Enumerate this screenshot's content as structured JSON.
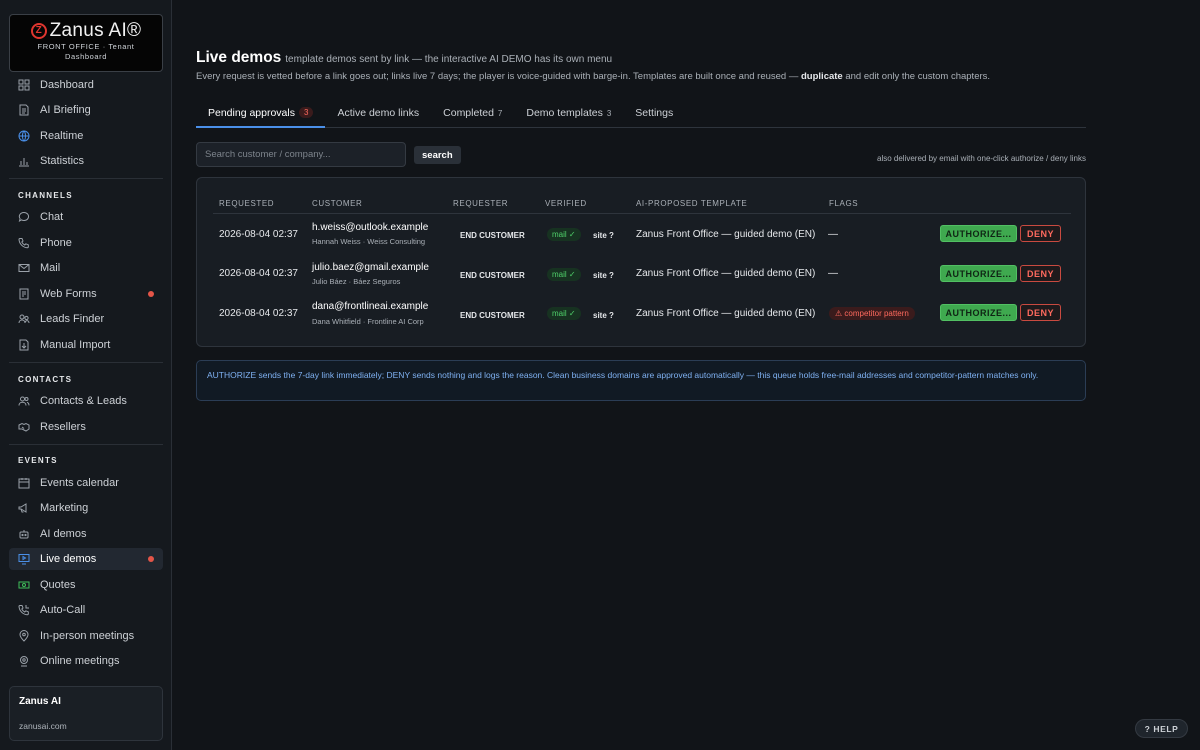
{
  "brand": {
    "logo_mark": "Z",
    "logo_text": "Zanus AI®",
    "line1": "FRONT OFFICE · Tenant",
    "line2": "Dashboard"
  },
  "nav": {
    "top": [
      {
        "label": "Dashboard",
        "icon": "grid-icon"
      },
      {
        "label": "AI Briefing",
        "icon": "document-icon"
      },
      {
        "label": "Realtime",
        "icon": "globe-icon"
      },
      {
        "label": "Statistics",
        "icon": "bar-chart-icon"
      }
    ],
    "channels_label": "CHANNELS",
    "channels": [
      {
        "label": "Chat",
        "icon": "chat-bubble-icon"
      },
      {
        "label": "Phone",
        "icon": "phone-icon"
      },
      {
        "label": "Mail",
        "icon": "mail-icon"
      },
      {
        "label": "Web Forms",
        "icon": "form-icon",
        "dot": true
      },
      {
        "label": "Leads Finder",
        "icon": "leads-finder-icon"
      },
      {
        "label": "Manual Import",
        "icon": "import-icon"
      }
    ],
    "contacts_label": "CONTACTS",
    "contacts": [
      {
        "label": "Contacts & Leads",
        "icon": "users-icon"
      },
      {
        "label": "Resellers",
        "icon": "handshake-icon"
      }
    ],
    "events_label": "EVENTS",
    "events": [
      {
        "label": "Events calendar",
        "icon": "calendar-icon"
      },
      {
        "label": "Marketing",
        "icon": "megaphone-icon"
      },
      {
        "label": "AI demos",
        "icon": "robot-icon"
      },
      {
        "label": "Live demos",
        "icon": "monitor-play-icon",
        "active": true,
        "dot": true
      },
      {
        "label": "Quotes",
        "icon": "money-icon"
      },
      {
        "label": "Auto-Call",
        "icon": "auto-call-icon"
      },
      {
        "label": "In-person meetings",
        "icon": "map-pin-icon"
      },
      {
        "label": "Online meetings",
        "icon": "webcam-icon"
      }
    ]
  },
  "tenant": {
    "name": "Zanus AI",
    "domain": "zanusai.com"
  },
  "page": {
    "title": "Live demos",
    "subtitle": "template demos sent by link — the interactive AI DEMO has its own menu",
    "desc_part1": "Every request is vetted before a link goes out; links live 7 days; the player is voice-guided with barge-in. Templates are built once and reused — ",
    "desc_bold": "duplicate",
    "desc_part2": " and edit only the custom chapters."
  },
  "tabs": [
    {
      "label": "Pending approvals",
      "count": "3",
      "active": true
    },
    {
      "label": "Active demo links",
      "count": ""
    },
    {
      "label": "Completed",
      "count": "7"
    },
    {
      "label": "Demo templates",
      "count": "3"
    },
    {
      "label": "Settings",
      "count": ""
    }
  ],
  "search": {
    "placeholder": "Search customer / company...",
    "value": "",
    "button": "search",
    "note": "also delivered by email with one-click authorize / deny links"
  },
  "table": {
    "headers": [
      "REQUESTED",
      "CUSTOMER",
      "REQUESTER",
      "VERIFIED",
      "AI-PROPOSED TEMPLATE",
      "FLAGS"
    ],
    "rows": [
      {
        "requested": "2026-08-04 02:37",
        "email": "h.weiss@outlook.example",
        "name": "Hannah Weiss · Weiss Consulting",
        "requester": "END CUSTOMER",
        "verified_mail": "mail ✓",
        "verified_site": "site ?",
        "template": "Zanus Front Office — guided demo (EN)",
        "flag": "—",
        "flag_type": "none"
      },
      {
        "requested": "2026-08-04 02:37",
        "email": "julio.baez@gmail.example",
        "name": "Julio Báez · Báez Seguros",
        "requester": "END CUSTOMER",
        "verified_mail": "mail ✓",
        "verified_site": "site ?",
        "template": "Zanus Front Office — guided demo (EN)",
        "flag": "—",
        "flag_type": "none"
      },
      {
        "requested": "2026-08-04 02:37",
        "email": "dana@frontlineai.example",
        "name": "Dana Whitfield · Frontline AI Corp",
        "requester": "END CUSTOMER",
        "verified_mail": "mail ✓",
        "verified_site": "site ?",
        "template": "Zanus Front Office — guided demo (EN)",
        "flag": "⚠ competitor pattern",
        "flag_type": "warning"
      }
    ],
    "authorize_label": "AUTHORIZE...",
    "deny_label": "DENY"
  },
  "info": "AUTHORIZE sends the 7-day link immediately; DENY sends nothing and logs the reason. Clean business domains are approved automatically — this queue holds free-mail addresses and competitor-pattern matches only.",
  "help_label": "? HELP",
  "colors": {
    "background": "#111418",
    "sidebar": "#15191e",
    "accent_blue": "#4a8fe8",
    "authorize_green": "#3fa94f",
    "deny_red": "#ff6a5e",
    "brand_red": "#e0362f"
  }
}
